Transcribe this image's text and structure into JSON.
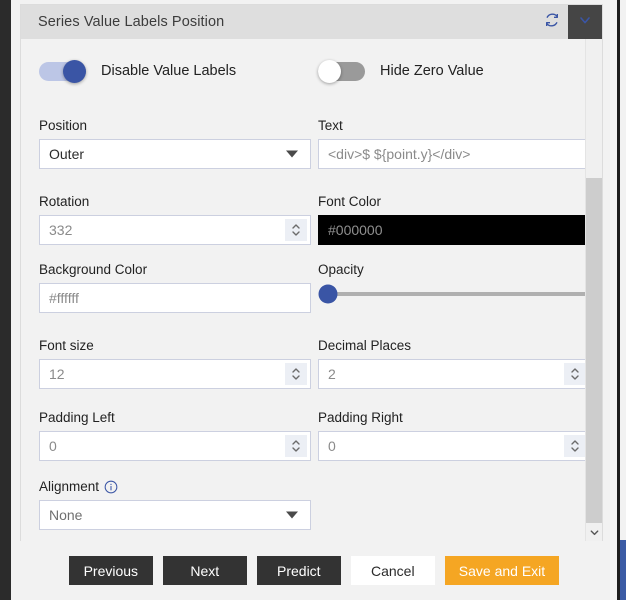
{
  "panel": {
    "title": "Series Value Labels Position",
    "refresh_icon": "refresh-icon",
    "collapse_icon": "chevron-down-icon"
  },
  "toggles": [
    {
      "label": "Disable Value Labels",
      "state": "on"
    },
    {
      "label": "Hide Zero Value",
      "state": "off"
    }
  ],
  "fields": {
    "position": {
      "label": "Position",
      "value": "Outer",
      "type": "select"
    },
    "text": {
      "label": "Text",
      "value": "<div>$ ${point.y}</div>",
      "type": "text"
    },
    "rotation": {
      "label": "Rotation",
      "value": "332",
      "type": "number"
    },
    "font_color": {
      "label": "Font Color",
      "value": "#000000",
      "type": "color",
      "swatch": "#000000"
    },
    "background_color": {
      "label": "Background Color",
      "value": "#ffffff",
      "type": "color",
      "swatch": "#ffffff"
    },
    "opacity": {
      "label": "Opacity",
      "value": "0",
      "type": "slider",
      "min": "0",
      "max": "100"
    },
    "font_size": {
      "label": "Font size",
      "value": "12",
      "type": "number"
    },
    "decimal_places": {
      "label": "Decimal Places",
      "value": "2",
      "type": "number"
    },
    "padding_left": {
      "label": "Padding Left",
      "value": "0",
      "type": "number"
    },
    "padding_right": {
      "label": "Padding Right",
      "value": "0",
      "type": "number"
    },
    "alignment": {
      "label": "Alignment",
      "value": "None",
      "type": "select",
      "info_icon": "info-icon"
    }
  },
  "scrollbar": {
    "down_arrow_icon": "chevron-down-icon"
  },
  "footer": {
    "previous": "Previous",
    "next": "Next",
    "predict": "Predict",
    "cancel": "Cancel",
    "save_and_exit": "Save and Exit"
  },
  "colors": {
    "accent_blue": "#3a55a5",
    "accent_orange": "#f5a623",
    "header_bg": "#dedede",
    "panel_bg": "#f2f2f2"
  }
}
